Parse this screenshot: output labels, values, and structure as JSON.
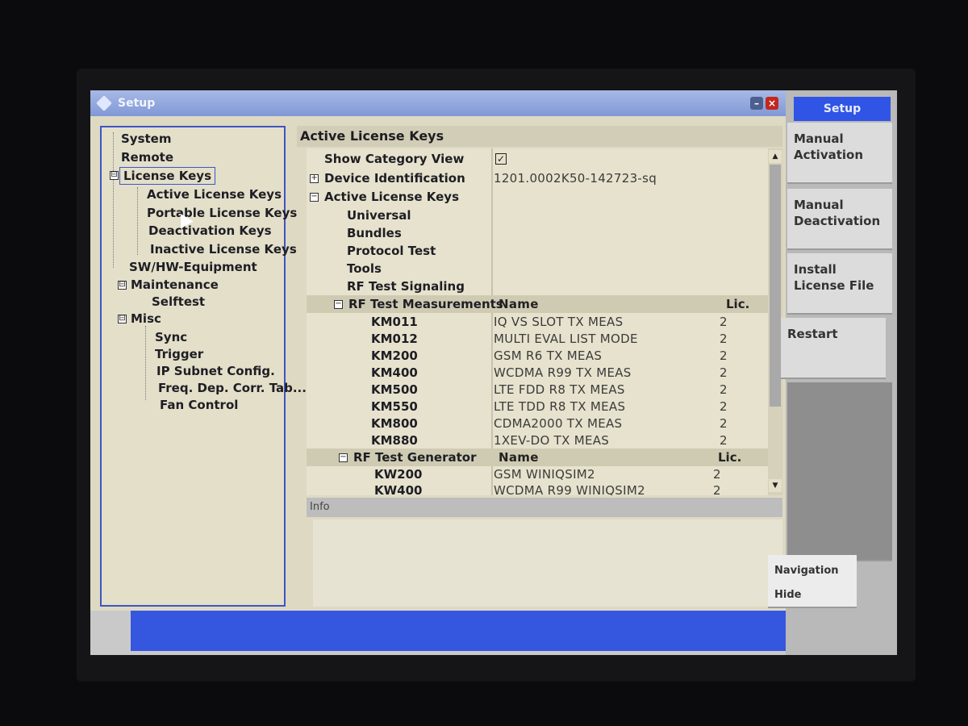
{
  "window": {
    "title": "Setup"
  },
  "tree": {
    "items": [
      {
        "label": "System"
      },
      {
        "label": "Remote"
      },
      {
        "label": "License Keys",
        "expander": "⊟"
      },
      {
        "label": "Active License Keys"
      },
      {
        "label": "Portable License Keys"
      },
      {
        "label": "Deactivation Keys"
      },
      {
        "label": "Inactive License Keys"
      },
      {
        "label": "SW/HW-Equipment"
      },
      {
        "label": "Maintenance",
        "expander": "⊟"
      },
      {
        "label": "Selftest"
      },
      {
        "label": "Misc",
        "expander": "⊟"
      },
      {
        "label": "Sync"
      },
      {
        "label": "Trigger"
      },
      {
        "label": "IP Subnet Config."
      },
      {
        "label": "Freq. Dep. Corr. Tab..."
      },
      {
        "label": "Fan Control"
      }
    ]
  },
  "panel": {
    "title": "Active License Keys",
    "show_category_view": {
      "label": "Show Category View",
      "checked": "✓"
    },
    "device_identification": {
      "label": "Device Identification",
      "value": "1201.0002K50-142723-sq"
    },
    "active_license_keys": {
      "label": "Active License Keys"
    },
    "categories": [
      "Universal",
      "Bundles",
      "Protocol Test",
      "Tools",
      "RF Test Signaling"
    ],
    "rf_test_measurements": {
      "label": "RF Test Measurements",
      "name_header": "Name",
      "lic_header": "Lic.",
      "rows": [
        {
          "key": "KM011",
          "name": "IQ VS SLOT TX MEAS",
          "lic": "2"
        },
        {
          "key": "KM012",
          "name": "MULTI EVAL LIST MODE",
          "lic": "2"
        },
        {
          "key": "KM200",
          "name": "GSM R6 TX MEAS",
          "lic": "2"
        },
        {
          "key": "KM400",
          "name": "WCDMA R99 TX MEAS",
          "lic": "2"
        },
        {
          "key": "KM500",
          "name": "LTE FDD R8 TX MEAS",
          "lic": "2"
        },
        {
          "key": "KM550",
          "name": "LTE TDD R8 TX MEAS",
          "lic": "2"
        },
        {
          "key": "KM800",
          "name": "CDMA2000 TX MEAS",
          "lic": "2"
        },
        {
          "key": "KM880",
          "name": "1XEV-DO TX MEAS",
          "lic": "2"
        }
      ]
    },
    "rf_test_generator": {
      "label": "RF Test Generator",
      "name_header": "Name",
      "lic_header": "Lic.",
      "rows": [
        {
          "key": "KW200",
          "name": "GSM WINIQSIM2",
          "lic": "2"
        },
        {
          "key": "KW400",
          "name": "WCDMA R99 WINIQSIM2",
          "lic": "2"
        }
      ]
    },
    "info_label": "Info"
  },
  "softkeys": {
    "title": "Setup",
    "manual_activation": "Manual Activation",
    "manual_deactivation": "Manual Deactivation",
    "install_license_file": "Install License File",
    "restart": "Restart",
    "navigation": "Navigation",
    "hide": "Hide"
  },
  "colors": {
    "title_bar": "#8098d6",
    "selection_border": "#3d56c8",
    "status_bar": "#3556df",
    "softkey_title": "#2f54e6"
  }
}
